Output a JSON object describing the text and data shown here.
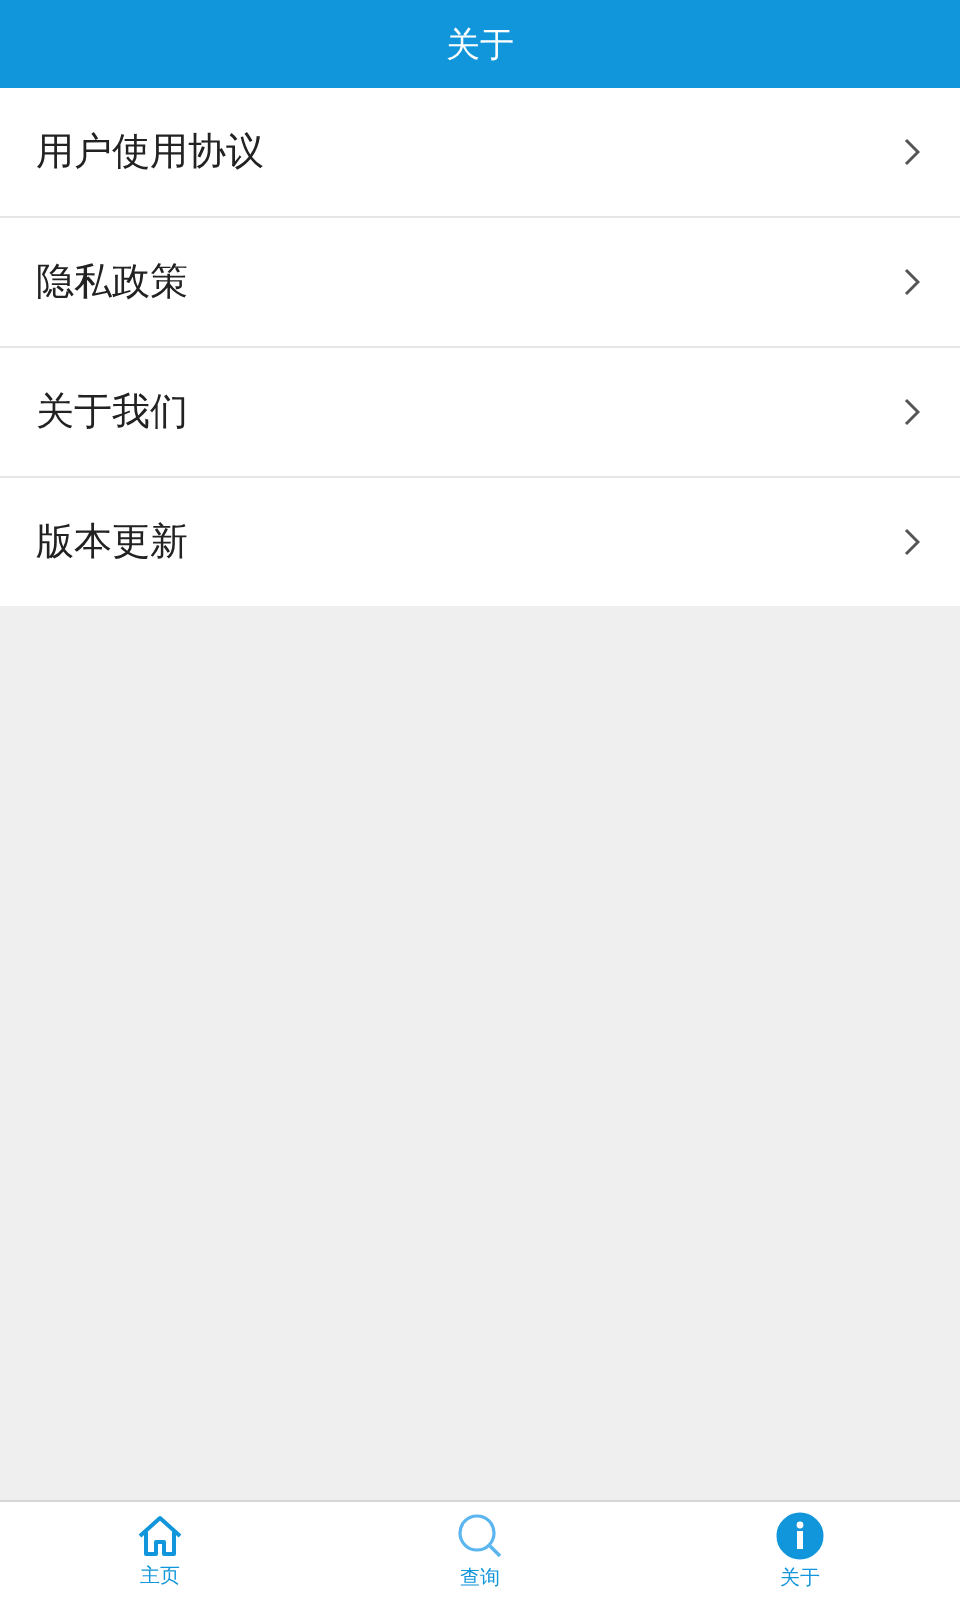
{
  "header": {
    "title": "关于"
  },
  "menu": [
    {
      "label": "用户使用协议"
    },
    {
      "label": "隐私政策"
    },
    {
      "label": "关于我们"
    },
    {
      "label": "版本更新"
    }
  ],
  "tabs": [
    {
      "label": "主页",
      "kind": "home",
      "selected": false
    },
    {
      "label": "查询",
      "kind": "search",
      "selected": false
    },
    {
      "label": "关于",
      "kind": "info",
      "selected": true
    }
  ]
}
